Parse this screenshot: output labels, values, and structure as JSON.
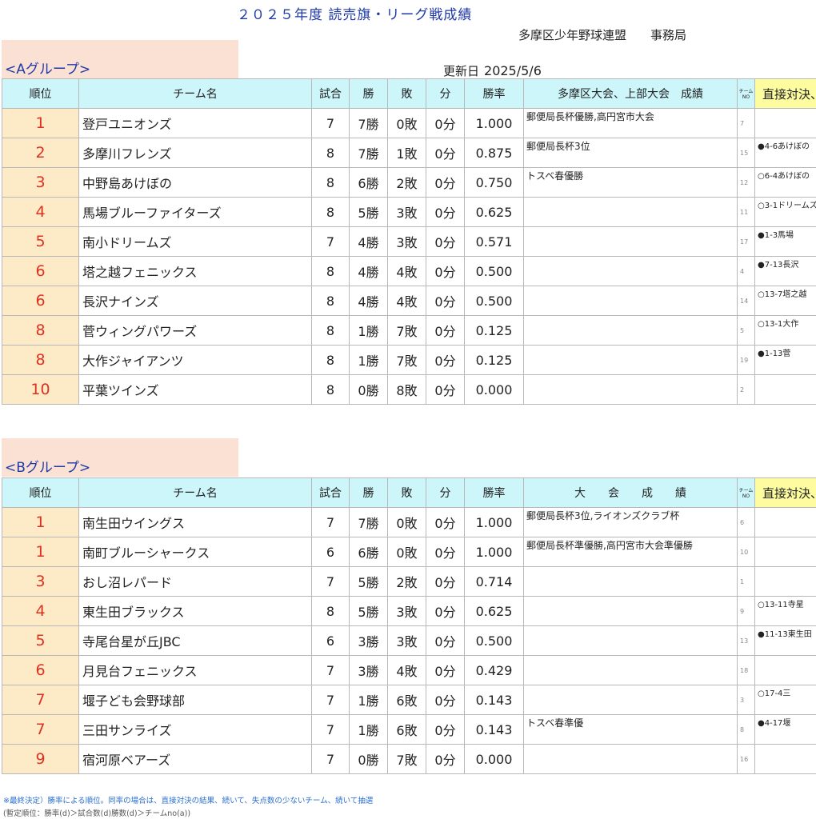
{
  "header": {
    "title": "２０２５年度 読売旗・リーグ戦成績",
    "organization": "多摩区少年野球連盟　　事務局"
  },
  "columns": {
    "rank": "順位",
    "team": "チーム名",
    "games": "試合",
    "wins": "勝",
    "losses": "敗",
    "draws": "分",
    "pct": "勝率",
    "team_no": "チーム\nNO",
    "direct": "直接対決、失点"
  },
  "groupA": {
    "label": "<Aグループ>",
    "updated_label": "更新日",
    "updated_value": "2025/5/6",
    "results_header": "多摩区大会、上部大会　成績",
    "rows": [
      {
        "rank": "1",
        "team": "登戸ユニオンズ",
        "games": "7",
        "wins": "7勝",
        "losses": "0敗",
        "draws": "0分",
        "pct": "1.000",
        "results": "郵便局長杯優勝,高円宮市大会",
        "no": "7",
        "direct": ""
      },
      {
        "rank": "2",
        "team": "多摩川フレンズ",
        "games": "8",
        "wins": "7勝",
        "losses": "1敗",
        "draws": "0分",
        "pct": "0.875",
        "results": "郵便局長杯3位",
        "no": "15",
        "direct": "●4-6あけぼの"
      },
      {
        "rank": "3",
        "team": "中野島あけぼの",
        "games": "8",
        "wins": "6勝",
        "losses": "2敗",
        "draws": "0分",
        "pct": "0.750",
        "results": "トスベ春優勝",
        "no": "12",
        "direct": "○6-4あけぼの"
      },
      {
        "rank": "4",
        "team": "馬場ブルーファイターズ",
        "games": "8",
        "wins": "5勝",
        "losses": "3敗",
        "draws": "0分",
        "pct": "0.625",
        "results": "",
        "no": "11",
        "direct": "○3-1ドリームズ"
      },
      {
        "rank": "5",
        "team": "南小ドリームズ",
        "games": "7",
        "wins": "4勝",
        "losses": "3敗",
        "draws": "0分",
        "pct": "0.571",
        "results": "",
        "no": "17",
        "direct": "●1-3馬場"
      },
      {
        "rank": "6",
        "team": "塔之越フェニックス",
        "games": "8",
        "wins": "4勝",
        "losses": "4敗",
        "draws": "0分",
        "pct": "0.500",
        "results": "",
        "no": "4",
        "direct": "●7-13長沢"
      },
      {
        "rank": "6",
        "team": "長沢ナインズ",
        "games": "8",
        "wins": "4勝",
        "losses": "4敗",
        "draws": "0分",
        "pct": "0.500",
        "results": "",
        "no": "14",
        "direct": "○13-7塔之越"
      },
      {
        "rank": "8",
        "team": "菅ウィングパワーズ",
        "games": "8",
        "wins": "1勝",
        "losses": "7敗",
        "draws": "0分",
        "pct": "0.125",
        "results": "",
        "no": "5",
        "direct": "○13-1大作"
      },
      {
        "rank": "8",
        "team": "大作ジャイアンツ",
        "games": "8",
        "wins": "1勝",
        "losses": "7敗",
        "draws": "0分",
        "pct": "0.125",
        "results": "",
        "no": "19",
        "direct": "●1-13菅"
      },
      {
        "rank": "10",
        "team": "平葉ツインズ",
        "games": "8",
        "wins": "0勝",
        "losses": "8敗",
        "draws": "0分",
        "pct": "0.000",
        "results": "",
        "no": "2",
        "direct": ""
      }
    ]
  },
  "groupB": {
    "label": "<Bグループ>",
    "results_header": "大　　会　　成　　績",
    "rows": [
      {
        "rank": "1",
        "team": "南生田ウイングス",
        "games": "7",
        "wins": "7勝",
        "losses": "0敗",
        "draws": "0分",
        "pct": "1.000",
        "results": "郵便局長杯3位,ライオンズクラブ杯",
        "no": "6",
        "direct": ""
      },
      {
        "rank": "1",
        "team": "南町ブルーシャークス",
        "games": "6",
        "wins": "6勝",
        "losses": "0敗",
        "draws": "0分",
        "pct": "1.000",
        "results": "郵便局長杯準優勝,高円宮市大会準優勝",
        "no": "10",
        "direct": ""
      },
      {
        "rank": "3",
        "team": "おし沼レパード",
        "games": "7",
        "wins": "5勝",
        "losses": "2敗",
        "draws": "0分",
        "pct": "0.714",
        "results": "",
        "no": "1",
        "direct": ""
      },
      {
        "rank": "4",
        "team": "東生田ブラックス",
        "games": "8",
        "wins": "5勝",
        "losses": "3敗",
        "draws": "0分",
        "pct": "0.625",
        "results": "",
        "no": "9",
        "direct": "○13-11寺星"
      },
      {
        "rank": "5",
        "team": "寺尾台星が丘JBC",
        "games": "6",
        "wins": "3勝",
        "losses": "3敗",
        "draws": "0分",
        "pct": "0.500",
        "results": "",
        "no": "13",
        "direct": "●11-13東生田"
      },
      {
        "rank": "6",
        "team": "月見台フェニックス",
        "games": "7",
        "wins": "3勝",
        "losses": "4敗",
        "draws": "0分",
        "pct": "0.429",
        "results": "",
        "no": "18",
        "direct": ""
      },
      {
        "rank": "7",
        "team": "堰子ども会野球部",
        "games": "7",
        "wins": "1勝",
        "losses": "6敗",
        "draws": "0分",
        "pct": "0.143",
        "results": "",
        "no": "3",
        "direct": "○17-4三"
      },
      {
        "rank": "7",
        "team": "三田サンライズ",
        "games": "7",
        "wins": "1勝",
        "losses": "6敗",
        "draws": "0分",
        "pct": "0.143",
        "results": "トスベ春準優",
        "no": "8",
        "direct": "●4-17堰"
      },
      {
        "rank": "9",
        "team": "宿河原ベアーズ",
        "games": "7",
        "wins": "0勝",
        "losses": "7敗",
        "draws": "0分",
        "pct": "0.000",
        "results": "",
        "no": "16",
        "direct": ""
      }
    ]
  },
  "notes": {
    "line1": "※最終決定）勝率による順位。同率の場合は、直接対決の結果、続いて、失点数の少ないチーム、続いて抽選",
    "line2": "(暫定順位：勝率(d)＞試合数(d)勝数(d)＞チームno(a))"
  },
  "colors": {
    "title_blue": "#1f3aa8",
    "header_cyan": "#cdf6fb",
    "header_yellow": "#fdfda0",
    "rank_cell": "#fdebc8",
    "rank_text": "#e03020",
    "tab_bg": "#fbe0d4"
  }
}
